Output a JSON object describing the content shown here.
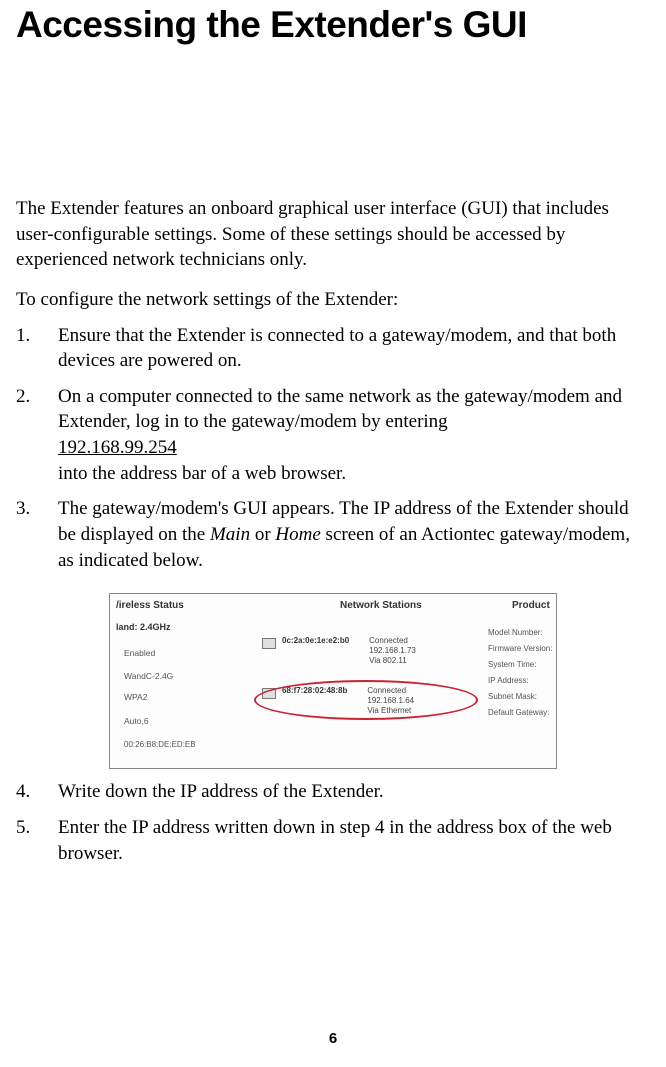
{
  "heading": "Accessing the Extender's GUI",
  "intro": "The Extender features an onboard graphical user interface (GUI) that includes user-configurable settings. Some of these settings should be accessed by experienced network technicians only.",
  "lead": "To configure the network settings of the Extender:",
  "steps": {
    "s1": {
      "num": "1.",
      "text": "Ensure that the Extender is connected to a gateway/modem, and that both devices are powered on."
    },
    "s2": {
      "num": "2.",
      "a": "On a computer connected to the same network as the gateway/modem and Extender, log in to the gateway/modem by entering",
      "ip": "192.168.99.254",
      "b": "into the address bar of a web browser."
    },
    "s3": {
      "num": "3.",
      "a": "The gateway/modem's GUI appears. The IP address of the Extender should be displayed on the ",
      "i1": "Main",
      "mid": " or ",
      "i2": "Home",
      "b": " screen of an Actiontec gateway/modem, as indicated below."
    },
    "s4": {
      "num": "4.",
      "text": "Write down the IP address of the Extender."
    },
    "s5": {
      "num": "5.",
      "text": "Enter the IP address written down in step 4 in the address box of the web browser."
    }
  },
  "figure": {
    "hdr_wireless": "/ireless Status",
    "hdr_network": "Network Stations",
    "hdr_product": "Product",
    "band": "land: 2.4GHz",
    "wcol": {
      "w1": "Enabled",
      "w2": "WandC-2.4G",
      "w3": "WPA2",
      "w4": "Auto,6",
      "w5": "00:26:B8:DE:ED:EB"
    },
    "ns1": {
      "mac": "0c:2a:0e:1e:e2:b0",
      "l1": "Connected",
      "l2": "192.168.1.73",
      "l3": "Via 802.11"
    },
    "ns2": {
      "mac": "68:f7:28:02:48:8b",
      "l1": "Connected",
      "l2": "192.168.1.64",
      "l3": "Via Ethernet"
    },
    "prod": {
      "p1": "Model Number:",
      "p2": "Firmware Version:",
      "p3": "System Time:",
      "p4": "IP Address:",
      "p5": "Subnet Mask:",
      "p6": "Default Gateway:"
    }
  },
  "page_number": "6"
}
